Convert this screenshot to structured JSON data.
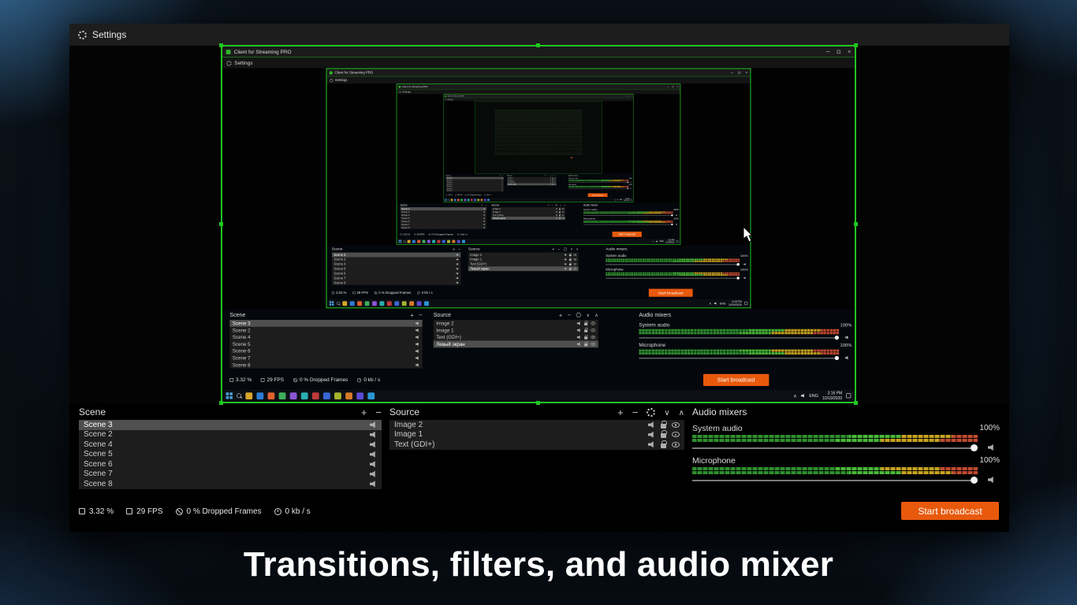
{
  "background_caption": "Transitions, filters, and audio mixer",
  "window": {
    "title": "Client for Streaming PRO",
    "menu": "Settings"
  },
  "scene_panel": {
    "title": "Scene",
    "items": [
      "Scene 3",
      "Scene 2",
      "Scene 4",
      "Scene 5",
      "Scene 6",
      "Scene 7",
      "Scene 8"
    ],
    "selected": "Scene 3"
  },
  "source_panel": {
    "title": "Source",
    "items": [
      "Image 2",
      "Image 1",
      "Text (GDI+)"
    ],
    "items_captured": [
      "Image 2",
      "Image 1",
      "Text (GDI+)",
      "Левый экран"
    ],
    "selected_captured": "Левый экран"
  },
  "audio_panel": {
    "title": "Audio mixers",
    "mixers": [
      {
        "name": "System audio",
        "level": "100%"
      },
      {
        "name": "Microphone",
        "level": "100%"
      }
    ]
  },
  "status": {
    "cpu": "3.32 %",
    "fps": "29 FPS",
    "dropped": "0 % Dropped Frames",
    "bitrate": "0 kb / s",
    "start_button": "Start broadcast"
  },
  "taskbar": {
    "language": "ENG",
    "time": "3:16 PM",
    "date": "10/19/2020"
  },
  "colors": {
    "capture_accent_green": "#21c521",
    "broadcast_orange": "#e8590c"
  }
}
